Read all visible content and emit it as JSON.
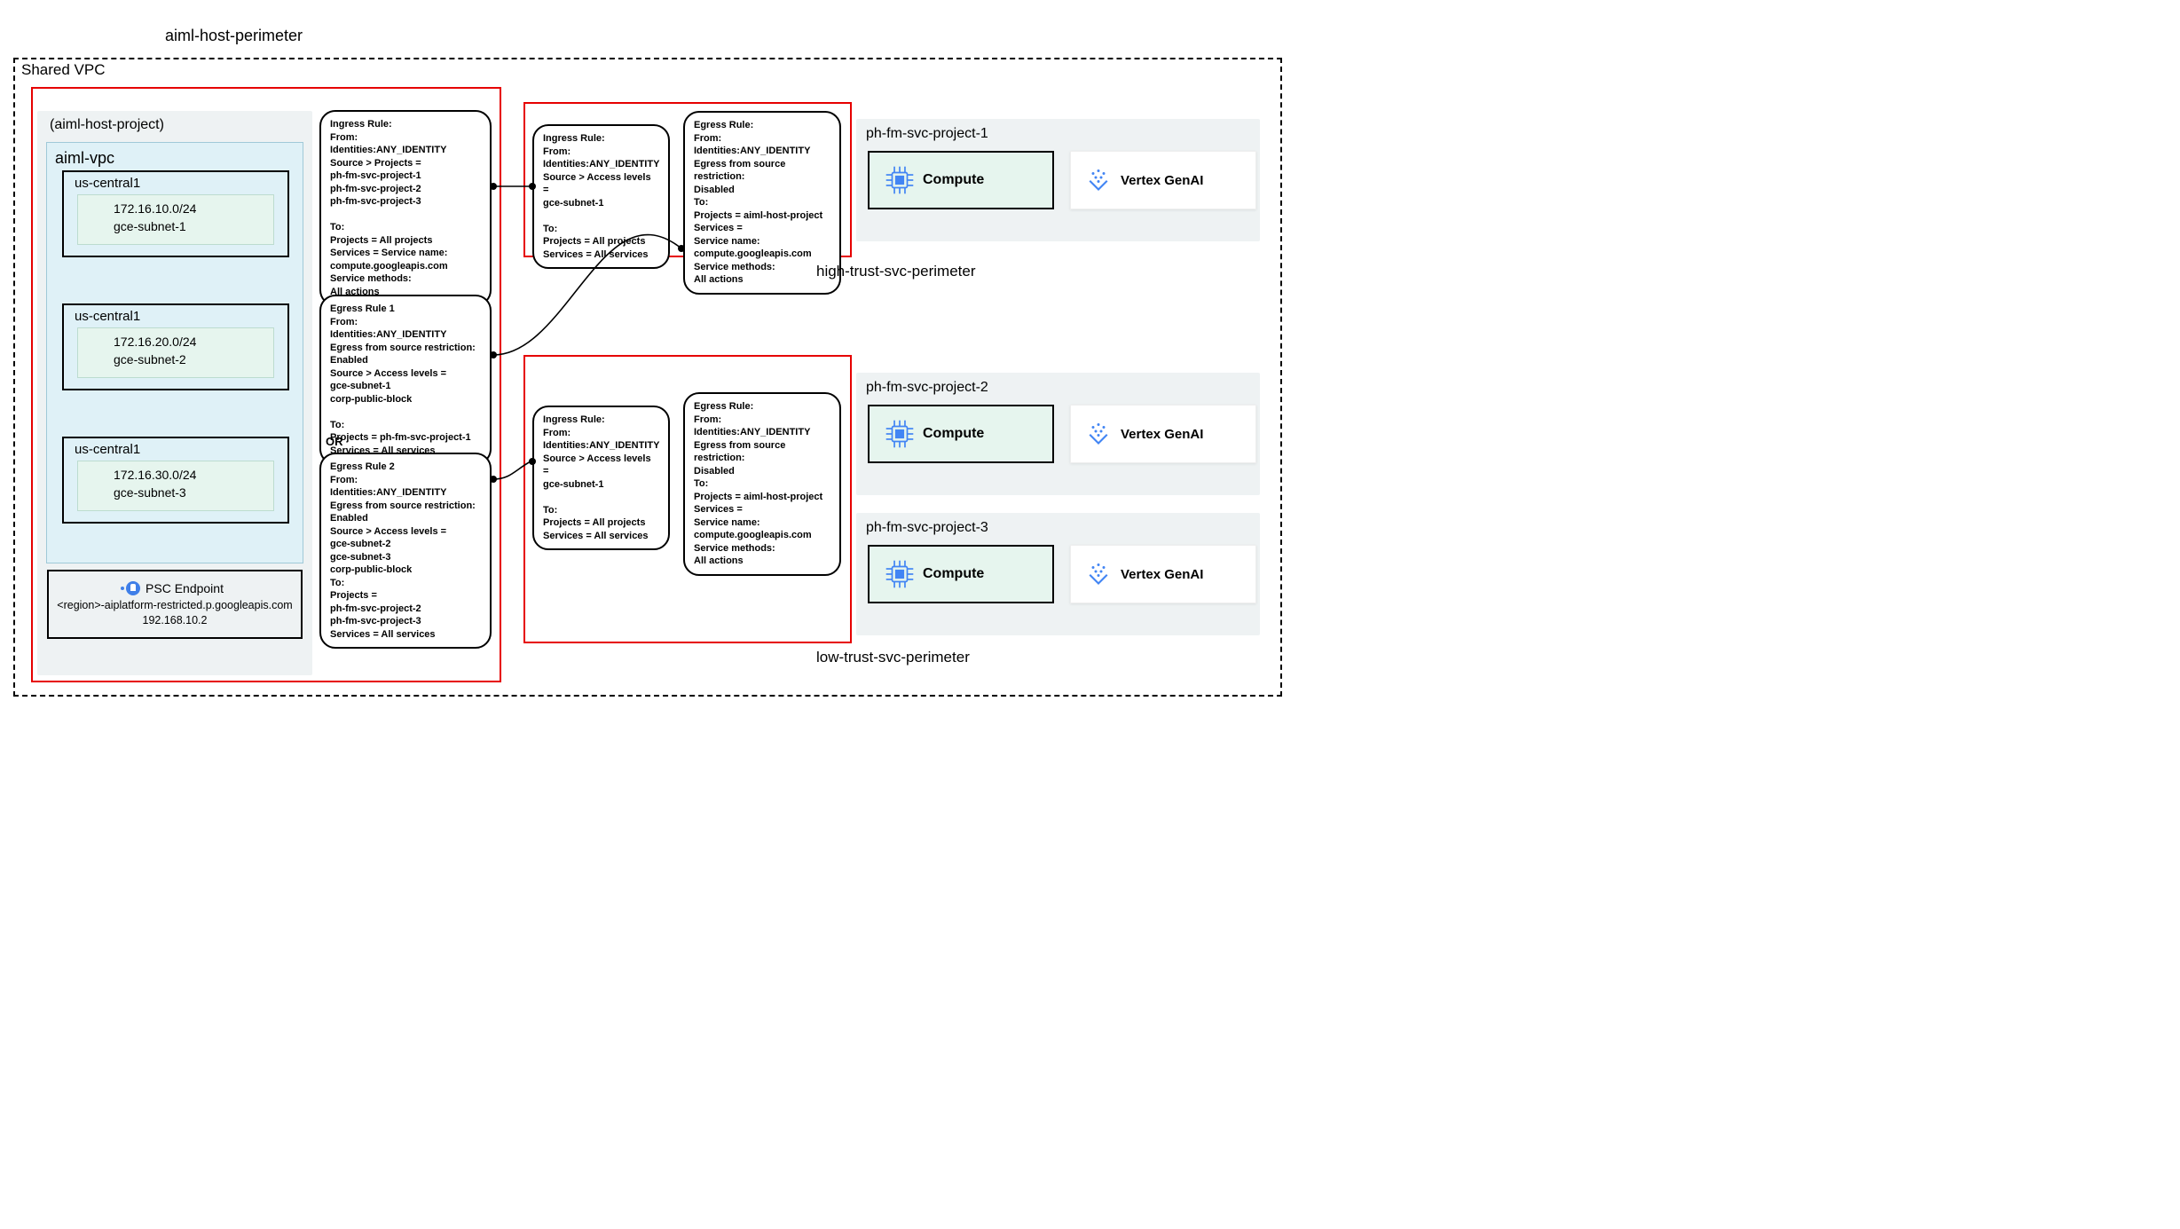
{
  "titles": {
    "host_perimeter": "aiml-host-perimeter",
    "shared_vpc": "Shared VPC",
    "host_project": "(aiml-host-project)",
    "vpc_name": "aiml-vpc",
    "high_trust": "high-trust-svc-perimeter",
    "low_trust": "low-trust-svc-perimeter"
  },
  "subnets": [
    {
      "region": "us-central1",
      "cidr": "172.16.10.0/24",
      "name": "gce-subnet-1"
    },
    {
      "region": "us-central1",
      "cidr": "172.16.20.0/24",
      "name": "gce-subnet-2"
    },
    {
      "region": "us-central1",
      "cidr": "172.16.30.0/24",
      "name": "gce-subnet-3"
    }
  ],
  "psc": {
    "title": "PSC Endpoint",
    "host": "<region>-aiplatform-restricted.p.googleapis.com",
    "ip": "192.168.10.2"
  },
  "rules": {
    "host_ingress": "Ingress Rule:\nFrom:\nIdentities:ANY_IDENTITY\nSource > Projects =\nph-fm-svc-project-1\nph-fm-svc-project-2\nph-fm-svc-project-3\n\nTo:\nProjects = All projects\nServices = Service name:\ncompute.googleapis.com\nService methods:\nAll actions",
    "host_egress_1": "Egress Rule 1\nFrom:\nIdentities:ANY_IDENTITY\nEgress from source restriction:\nEnabled\nSource > Access levels =\ngce-subnet-1\ncorp-public-block\n\nTo:\nProjects = ph-fm-svc-project-1\nServices = All services",
    "host_egress_2": "Egress Rule 2\nFrom:\nIdentities:ANY_IDENTITY\nEgress from source restriction:\nEnabled\nSource > Access levels =\ngce-subnet-2\ngce-subnet-3\ncorp-public-block\nTo:\nProjects =\nph-fm-svc-project-2\nph-fm-svc-project-3\nServices = All services",
    "high_ingress": "Ingress Rule:\nFrom:\nIdentities:ANY_IDENTITY\nSource > Access levels =\ngce-subnet-1\n\nTo:\nProjects = All projects\nServices = All services",
    "high_egress": "Egress Rule:\nFrom:\nIdentities:ANY_IDENTITY\nEgress from source restriction:\nDisabled\nTo:\nProjects = aiml-host-project\nServices =\nService name:\ncompute.googleapis.com\nService methods:\nAll actions",
    "low_ingress": "Ingress Rule:\nFrom:\nIdentities:ANY_IDENTITY\nSource > Access levels =\ngce-subnet-1\n\nTo:\nProjects = All projects\nServices = All services",
    "low_egress": "Egress Rule:\nFrom:\nIdentities:ANY_IDENTITY\nEgress from source restriction:\nDisabled\nTo:\nProjects = aiml-host-project\nServices =\nService name:\ncompute.googleapis.com\nService methods:\nAll actions"
  },
  "or_label": "OR",
  "svc_projects": {
    "p1": "ph-fm-svc-project-1",
    "p2": "ph-fm-svc-project-2",
    "p3": "ph-fm-svc-project-3"
  },
  "labels": {
    "compute": "Compute",
    "vertex": "Vertex GenAI"
  }
}
